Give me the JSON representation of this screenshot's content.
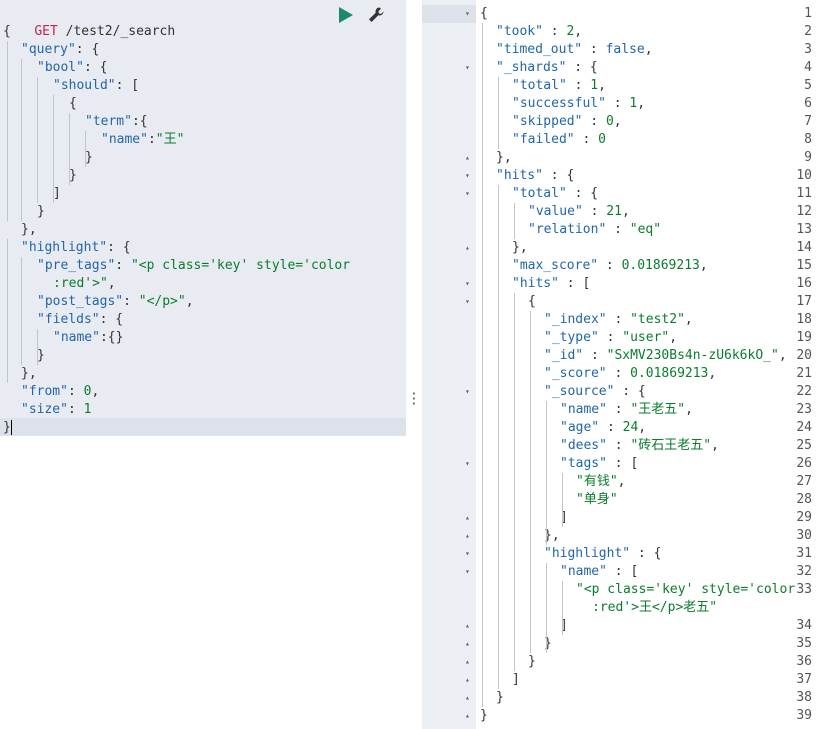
{
  "request": {
    "method": "GET",
    "path": "/test2/_search",
    "run_icon": "play-icon",
    "settings_icon": "wrench-icon"
  },
  "request_lines": [
    [
      {
        "t": "p",
        "v": "{"
      }
    ],
    [
      {
        "t": "k",
        "v": "\"query\""
      },
      {
        "t": "p",
        "v": ": {"
      }
    ],
    [
      {
        "t": "k",
        "v": "\"bool\""
      },
      {
        "t": "p",
        "v": ": {"
      }
    ],
    [
      {
        "t": "k",
        "v": "\"should\""
      },
      {
        "t": "p",
        "v": ": ["
      }
    ],
    [
      {
        "t": "p",
        "v": "{"
      }
    ],
    [
      {
        "t": "k",
        "v": "\"term\""
      },
      {
        "t": "p",
        "v": ":{"
      }
    ],
    [
      {
        "t": "k",
        "v": "\"name\""
      },
      {
        "t": "p",
        "v": ":"
      },
      {
        "t": "s",
        "v": "\"王\""
      }
    ],
    [
      {
        "t": "p",
        "v": "}"
      }
    ],
    [
      {
        "t": "p",
        "v": "}"
      }
    ],
    [
      {
        "t": "p",
        "v": "]"
      }
    ],
    [
      {
        "t": "p",
        "v": "}"
      }
    ],
    [
      {
        "t": "p",
        "v": "},"
      }
    ],
    [
      {
        "t": "k",
        "v": "\"highlight\""
      },
      {
        "t": "p",
        "v": ": {"
      }
    ],
    [
      {
        "t": "k",
        "v": "\"pre_tags\""
      },
      {
        "t": "p",
        "v": ": "
      },
      {
        "t": "s",
        "v": "\"<p class='key' style='color"
      }
    ],
    [
      {
        "t": "s",
        "v": ":red'>\""
      },
      {
        "t": "p",
        "v": ","
      }
    ],
    [
      {
        "t": "k",
        "v": "\"post_tags\""
      },
      {
        "t": "p",
        "v": ": "
      },
      {
        "t": "s",
        "v": "\"</p>\""
      },
      {
        "t": "p",
        "v": ","
      }
    ],
    [
      {
        "t": "k",
        "v": "\"fields\""
      },
      {
        "t": "p",
        "v": ": {"
      }
    ],
    [
      {
        "t": "k",
        "v": "\"name\""
      },
      {
        "t": "p",
        "v": ":{}"
      }
    ],
    [
      {
        "t": "p",
        "v": "}"
      }
    ],
    [
      {
        "t": "p",
        "v": "},"
      }
    ],
    [
      {
        "t": "k",
        "v": "\"from\""
      },
      {
        "t": "p",
        "v": ": "
      },
      {
        "t": "n",
        "v": "0"
      },
      {
        "t": "p",
        "v": ","
      }
    ],
    [
      {
        "t": "k",
        "v": "\"size\""
      },
      {
        "t": "p",
        "v": ": "
      },
      {
        "t": "n",
        "v": "1"
      }
    ],
    [
      {
        "t": "p",
        "v": "}"
      }
    ]
  ],
  "response_lines": [
    {
      "n": "1",
      "fold": "▾",
      "parts": [
        {
          "t": "p",
          "v": "{"
        }
      ]
    },
    {
      "n": "2",
      "parts": [
        {
          "t": "k",
          "v": "\"took\""
        },
        {
          "t": "p",
          "v": " : "
        },
        {
          "t": "n",
          "v": "2"
        },
        {
          "t": "p",
          "v": ","
        }
      ]
    },
    {
      "n": "3",
      "parts": [
        {
          "t": "k",
          "v": "\"timed_out\""
        },
        {
          "t": "p",
          "v": " : "
        },
        {
          "t": "b",
          "v": "false"
        },
        {
          "t": "p",
          "v": ","
        }
      ]
    },
    {
      "n": "4",
      "fold": "▾",
      "parts": [
        {
          "t": "k",
          "v": "\"_shards\""
        },
        {
          "t": "p",
          "v": " : {"
        }
      ]
    },
    {
      "n": "5",
      "parts": [
        {
          "t": "k",
          "v": "\"total\""
        },
        {
          "t": "p",
          "v": " : "
        },
        {
          "t": "n",
          "v": "1"
        },
        {
          "t": "p",
          "v": ","
        }
      ]
    },
    {
      "n": "6",
      "parts": [
        {
          "t": "k",
          "v": "\"successful\""
        },
        {
          "t": "p",
          "v": " : "
        },
        {
          "t": "n",
          "v": "1"
        },
        {
          "t": "p",
          "v": ","
        }
      ]
    },
    {
      "n": "7",
      "parts": [
        {
          "t": "k",
          "v": "\"skipped\""
        },
        {
          "t": "p",
          "v": " : "
        },
        {
          "t": "n",
          "v": "0"
        },
        {
          "t": "p",
          "v": ","
        }
      ]
    },
    {
      "n": "8",
      "parts": [
        {
          "t": "k",
          "v": "\"failed\""
        },
        {
          "t": "p",
          "v": " : "
        },
        {
          "t": "n",
          "v": "0"
        }
      ]
    },
    {
      "n": "9",
      "fold": "▴",
      "parts": [
        {
          "t": "p",
          "v": "},"
        }
      ]
    },
    {
      "n": "10",
      "fold": "▾",
      "parts": [
        {
          "t": "k",
          "v": "\"hits\""
        },
        {
          "t": "p",
          "v": " : {"
        }
      ]
    },
    {
      "n": "11",
      "fold": "▾",
      "parts": [
        {
          "t": "k",
          "v": "\"total\""
        },
        {
          "t": "p",
          "v": " : {"
        }
      ]
    },
    {
      "n": "12",
      "parts": [
        {
          "t": "k",
          "v": "\"value\""
        },
        {
          "t": "p",
          "v": " : "
        },
        {
          "t": "n",
          "v": "21"
        },
        {
          "t": "p",
          "v": ","
        }
      ]
    },
    {
      "n": "13",
      "parts": [
        {
          "t": "k",
          "v": "\"relation\""
        },
        {
          "t": "p",
          "v": " : "
        },
        {
          "t": "s",
          "v": "\"eq\""
        }
      ]
    },
    {
      "n": "14",
      "fold": "▴",
      "parts": [
        {
          "t": "p",
          "v": "},"
        }
      ]
    },
    {
      "n": "15",
      "parts": [
        {
          "t": "k",
          "v": "\"max_score\""
        },
        {
          "t": "p",
          "v": " : "
        },
        {
          "t": "n",
          "v": "0.01869213"
        },
        {
          "t": "p",
          "v": ","
        }
      ]
    },
    {
      "n": "16",
      "fold": "▾",
      "parts": [
        {
          "t": "k",
          "v": "\"hits\""
        },
        {
          "t": "p",
          "v": " : ["
        }
      ]
    },
    {
      "n": "17",
      "fold": "▾",
      "parts": [
        {
          "t": "p",
          "v": "{"
        }
      ]
    },
    {
      "n": "18",
      "parts": [
        {
          "t": "k",
          "v": "\"_index\""
        },
        {
          "t": "p",
          "v": " : "
        },
        {
          "t": "s",
          "v": "\"test2\""
        },
        {
          "t": "p",
          "v": ","
        }
      ]
    },
    {
      "n": "19",
      "parts": [
        {
          "t": "k",
          "v": "\"_type\""
        },
        {
          "t": "p",
          "v": " : "
        },
        {
          "t": "s",
          "v": "\"user\""
        },
        {
          "t": "p",
          "v": ","
        }
      ]
    },
    {
      "n": "20",
      "parts": [
        {
          "t": "k",
          "v": "\"_id\""
        },
        {
          "t": "p",
          "v": " : "
        },
        {
          "t": "s",
          "v": "\"SxMV230Bs4n-zU6k6kO_\""
        },
        {
          "t": "p",
          "v": ","
        }
      ]
    },
    {
      "n": "21",
      "parts": [
        {
          "t": "k",
          "v": "\"_score\""
        },
        {
          "t": "p",
          "v": " : "
        },
        {
          "t": "n",
          "v": "0.01869213"
        },
        {
          "t": "p",
          "v": ","
        }
      ]
    },
    {
      "n": "22",
      "fold": "▾",
      "parts": [
        {
          "t": "k",
          "v": "\"_source\""
        },
        {
          "t": "p",
          "v": " : {"
        }
      ]
    },
    {
      "n": "23",
      "parts": [
        {
          "t": "k",
          "v": "\"name\""
        },
        {
          "t": "p",
          "v": " : "
        },
        {
          "t": "s",
          "v": "\"王老五\""
        },
        {
          "t": "p",
          "v": ","
        }
      ]
    },
    {
      "n": "24",
      "parts": [
        {
          "t": "k",
          "v": "\"age\""
        },
        {
          "t": "p",
          "v": " : "
        },
        {
          "t": "n",
          "v": "24"
        },
        {
          "t": "p",
          "v": ","
        }
      ]
    },
    {
      "n": "25",
      "parts": [
        {
          "t": "k",
          "v": "\"dees\""
        },
        {
          "t": "p",
          "v": " : "
        },
        {
          "t": "s",
          "v": "\"砖石王老五\""
        },
        {
          "t": "p",
          "v": ","
        }
      ]
    },
    {
      "n": "26",
      "fold": "▾",
      "parts": [
        {
          "t": "k",
          "v": "\"tags\""
        },
        {
          "t": "p",
          "v": " : ["
        }
      ]
    },
    {
      "n": "27",
      "parts": [
        {
          "t": "s",
          "v": "\"有钱\""
        },
        {
          "t": "p",
          "v": ","
        }
      ]
    },
    {
      "n": "28",
      "parts": [
        {
          "t": "s",
          "v": "\"单身\""
        }
      ]
    },
    {
      "n": "29",
      "fold": "▴",
      "parts": [
        {
          "t": "p",
          "v": "]"
        }
      ]
    },
    {
      "n": "30",
      "fold": "▴",
      "parts": [
        {
          "t": "p",
          "v": "},"
        }
      ]
    },
    {
      "n": "31",
      "fold": "▾",
      "parts": [
        {
          "t": "k",
          "v": "\"highlight\""
        },
        {
          "t": "p",
          "v": " : {"
        }
      ]
    },
    {
      "n": "32",
      "fold": "▾",
      "parts": [
        {
          "t": "k",
          "v": "\"name\""
        },
        {
          "t": "p",
          "v": " : ["
        }
      ]
    },
    {
      "n": "33",
      "parts": [
        {
          "t": "s",
          "v": "\"<p class='key' style='color"
        }
      ]
    },
    {
      "n": "",
      "parts": [
        {
          "t": "s",
          "v": ":red'>王</p>老五\""
        }
      ]
    },
    {
      "n": "34",
      "fold": "▴",
      "parts": [
        {
          "t": "p",
          "v": "]"
        }
      ]
    },
    {
      "n": "35",
      "fold": "▴",
      "parts": [
        {
          "t": "p",
          "v": "}"
        }
      ]
    },
    {
      "n": "36",
      "fold": "▴",
      "parts": [
        {
          "t": "p",
          "v": "}"
        }
      ]
    },
    {
      "n": "37",
      "fold": "▴",
      "parts": [
        {
          "t": "p",
          "v": "]"
        }
      ]
    },
    {
      "n": "38",
      "fold": "▴",
      "parts": [
        {
          "t": "p",
          "v": "}"
        }
      ]
    },
    {
      "n": "39",
      "fold": "▴",
      "parts": [
        {
          "t": "p",
          "v": "}"
        }
      ]
    }
  ],
  "colors": {
    "key": "#2266aa",
    "string": "#0a7d2c",
    "method": "#c7254e",
    "run": "#1a8a6a"
  }
}
